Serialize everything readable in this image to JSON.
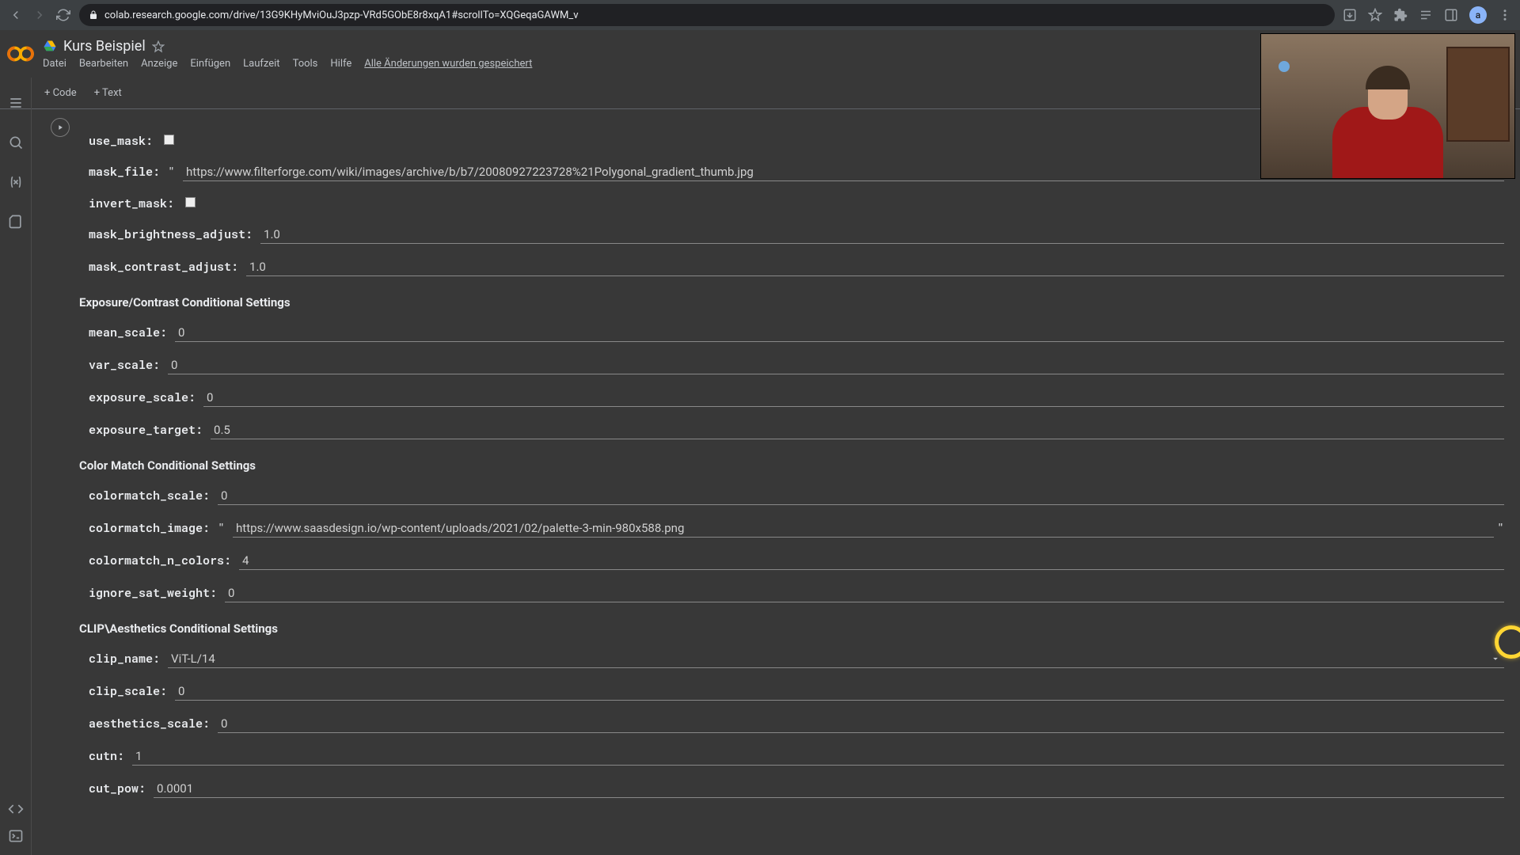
{
  "browser": {
    "url": "colab.research.google.com/drive/13G9KHyMviOuJ3pzp-VRd5GObE8r8xqA1#scrollTo=XQGeqaGAWM_v",
    "avatar_initial": "a"
  },
  "header": {
    "title": "Kurs Beispiel",
    "menus": [
      "Datei",
      "Bearbeiten",
      "Anzeige",
      "Einfügen",
      "Laufzeit",
      "Tools",
      "Hilfe"
    ],
    "save_status": "Alle Änderungen wurden gespeichert"
  },
  "toolbar": {
    "code": "+  Code",
    "text": "+  Text"
  },
  "form": {
    "use_mask_label": "use_mask:",
    "mask_file_label": "mask_file:",
    "mask_file_value": "https://www.filterforge.com/wiki/images/archive/b/b7/20080927223728%21Polygonal_gradient_thumb.jpg",
    "invert_mask_label": "invert_mask:",
    "mask_brightness_adjust_label": "mask_brightness_adjust:",
    "mask_brightness_adjust_value": "1.0",
    "mask_contrast_adjust_label": "mask_contrast_adjust:",
    "mask_contrast_adjust_value": "1.0",
    "section_exposure": "Exposure/Contrast Conditional Settings",
    "mean_scale_label": "mean_scale:",
    "mean_scale_value": "0",
    "var_scale_label": "var_scale:",
    "var_scale_value": "0",
    "exposure_scale_label": "exposure_scale:",
    "exposure_scale_value": "0",
    "exposure_target_label": "exposure_target:",
    "exposure_target_value": "0.5",
    "section_color": "Color Match Conditional Settings",
    "colormatch_scale_label": "colormatch_scale:",
    "colormatch_scale_value": "0",
    "colormatch_image_label": "colormatch_image:",
    "colormatch_image_value": "https://www.saasdesign.io/wp-content/uploads/2021/02/palette-3-min-980x588.png",
    "colormatch_n_colors_label": "colormatch_n_colors:",
    "colormatch_n_colors_value": "4",
    "ignore_sat_weight_label": "ignore_sat_weight:",
    "ignore_sat_weight_value": "0",
    "section_clip": "CLIP\\Aesthetics Conditional Settings",
    "clip_name_label": "clip_name:",
    "clip_name_value": "ViT-L/14",
    "clip_scale_label": "clip_scale:",
    "clip_scale_value": "0",
    "aesthetics_scale_label": "aesthetics_scale:",
    "aesthetics_scale_value": "0",
    "cutn_label": "cutn:",
    "cutn_value": "1",
    "cut_pow_label": "cut_pow:",
    "cut_pow_value": "0.0001"
  }
}
